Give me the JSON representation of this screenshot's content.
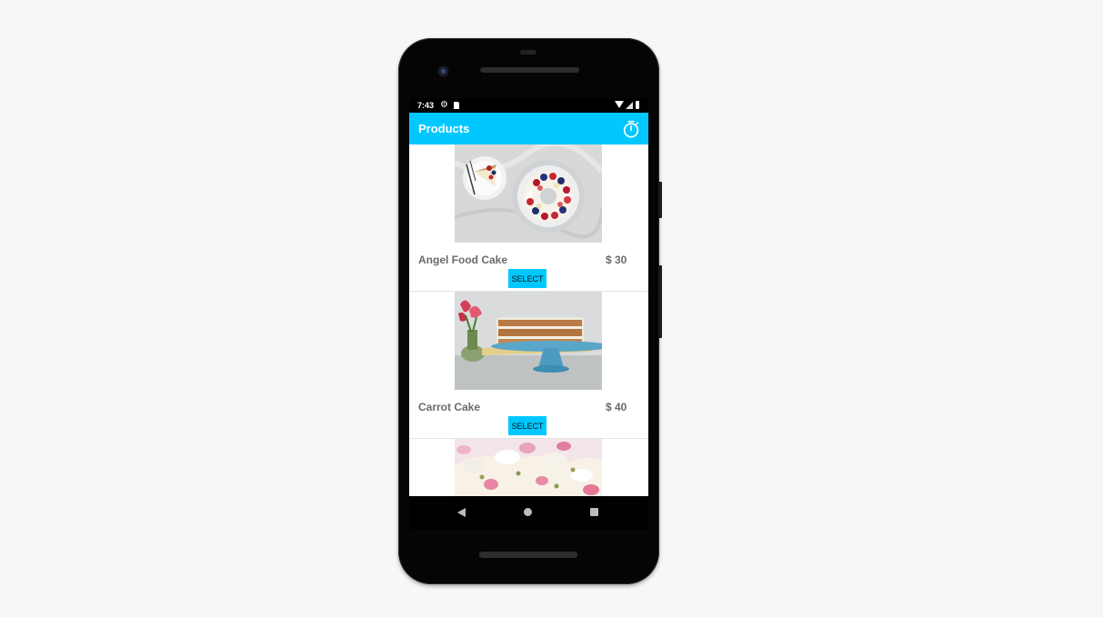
{
  "status_bar": {
    "time": "7:43",
    "icons": [
      "gear-icon",
      "sd-card-icon",
      "wifi-icon",
      "signal-icon",
      "battery-icon"
    ]
  },
  "app_bar": {
    "title": "Products",
    "action_icon": "timer-icon",
    "color": "#00c8ff"
  },
  "products": [
    {
      "name": "Angel Food Cake",
      "price": "$ 30",
      "button": "SELECT",
      "image": "angel-food-cake-photo"
    },
    {
      "name": "Carrot Cake",
      "price": "$ 40",
      "button": "SELECT",
      "image": "carrot-cake-photo"
    },
    {
      "image": "rose-cake-photo"
    }
  ],
  "nav_bar": {
    "icons": [
      "back-icon",
      "home-icon",
      "recents-icon"
    ]
  }
}
